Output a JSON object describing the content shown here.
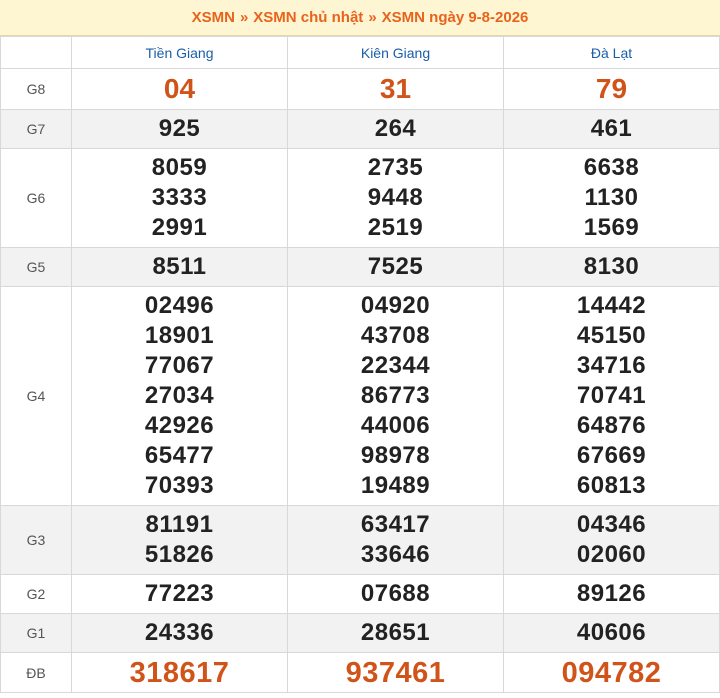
{
  "breadcrumb": {
    "items": [
      "XSMN",
      "XSMN chủ nhật",
      "XSMN ngày 9-8-2026"
    ],
    "separator": "»"
  },
  "provinces": [
    "Tiền Giang",
    "Kiên Giang",
    "Đà Lạt"
  ],
  "prizes": [
    {
      "label": "G8",
      "values": [
        [
          "04"
        ],
        [
          "31"
        ],
        [
          "79"
        ]
      ]
    },
    {
      "label": "G7",
      "values": [
        [
          "925"
        ],
        [
          "264"
        ],
        [
          "461"
        ]
      ]
    },
    {
      "label": "G6",
      "values": [
        [
          "8059",
          "3333",
          "2991"
        ],
        [
          "2735",
          "9448",
          "2519"
        ],
        [
          "6638",
          "1130",
          "1569"
        ]
      ]
    },
    {
      "label": "G5",
      "values": [
        [
          "8511"
        ],
        [
          "7525"
        ],
        [
          "8130"
        ]
      ]
    },
    {
      "label": "G4",
      "values": [
        [
          "02496",
          "18901",
          "77067",
          "27034",
          "42926",
          "65477",
          "70393"
        ],
        [
          "04920",
          "43708",
          "22344",
          "86773",
          "44006",
          "98978",
          "19489"
        ],
        [
          "14442",
          "45150",
          "34716",
          "70741",
          "64876",
          "67669",
          "60813"
        ]
      ]
    },
    {
      "label": "G3",
      "values": [
        [
          "81191",
          "51826"
        ],
        [
          "63417",
          "33646"
        ],
        [
          "04346",
          "02060"
        ]
      ]
    },
    {
      "label": "G2",
      "values": [
        [
          "77223"
        ],
        [
          "07688"
        ],
        [
          "89126"
        ]
      ]
    },
    {
      "label": "G1",
      "values": [
        [
          "24336"
        ],
        [
          "28651"
        ],
        [
          "40606"
        ]
      ]
    },
    {
      "label": "ĐB",
      "values": [
        [
          "318617"
        ],
        [
          "937461"
        ],
        [
          "094782"
        ]
      ]
    }
  ],
  "colors": {
    "accent": "#e8631c",
    "header_bg": "#fef5d3",
    "province": "#1a5ea8",
    "special": "#d0541a"
  }
}
